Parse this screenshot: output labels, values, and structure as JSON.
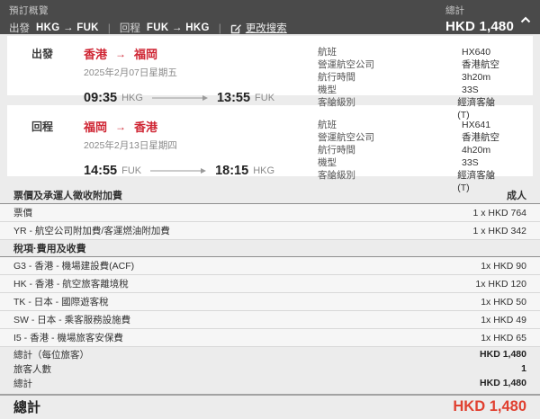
{
  "colors": {
    "header_bg": "#4a4a4a",
    "page_bg": "#ececec",
    "card_bg": "#ffffff",
    "brand_red": "#cf2634",
    "grand_total_red": "#e04030"
  },
  "icons": {
    "edit_icon": "edit-square-pencil",
    "chevron_up": "chevron-up",
    "route_arrow": "→"
  },
  "header": {
    "title": "預訂概覽",
    "depart_label": "出發",
    "depart_route": "HKG → FUK",
    "return_label": "回程",
    "return_route": "FUK → HKG",
    "change_search": "更改搜索",
    "total_label": "總計",
    "total_value": "HKD 1,480"
  },
  "flights": [
    {
      "direction_label": "出發",
      "from_city": "香港",
      "arrow": "→",
      "to_city": "福岡",
      "date": "2025年2月07日星期五",
      "dep_time": "09:35",
      "dep_code": "HKG",
      "arr_time": "13:55",
      "arr_code": "FUK",
      "details": [
        {
          "label": "航班",
          "value": "HX640"
        },
        {
          "label": "營運航空公司",
          "value": "香港航空"
        },
        {
          "label": "航行時間",
          "value": "3h20m"
        },
        {
          "label": "機型",
          "value": "33S"
        },
        {
          "label": "客艙級別",
          "value": "經濟客艙(T)"
        }
      ]
    },
    {
      "direction_label": "回程",
      "from_city": "福岡",
      "arrow": "→",
      "to_city": "香港",
      "date": "2025年2月13日星期四",
      "dep_time": "14:55",
      "dep_code": "FUK",
      "arr_time": "18:15",
      "arr_code": "HKG",
      "details": [
        {
          "label": "航班",
          "value": "HX641"
        },
        {
          "label": "營運航空公司",
          "value": "香港航空"
        },
        {
          "label": "航行時間",
          "value": "4h20m"
        },
        {
          "label": "機型",
          "value": "33S"
        },
        {
          "label": "客艙級別",
          "value": "經濟客艙(T)"
        }
      ]
    }
  ],
  "fare": {
    "section1_title": "票價及承運人徵收附加費",
    "pax_type": "成人",
    "section1_rows": [
      {
        "label": "票價",
        "value": "1 x HKD 764"
      },
      {
        "label": "YR - 航空公司附加費/客運燃油附加費",
        "value": "1 x HKD 342"
      }
    ],
    "section2_title": "稅項·費用及收費",
    "section2_rows": [
      {
        "label": "G3 - 香港 - 機場建設費(ACF)",
        "value": "1x HKD 90"
      },
      {
        "label": "HK - 香港 - 航空旅客離境稅",
        "value": "1x HKD 120"
      },
      {
        "label": "TK - 日本 - 國際遊客稅",
        "value": "1x HKD 50"
      },
      {
        "label": "SW - 日本 - 乘客服務設施費",
        "value": "1x HKD 49"
      },
      {
        "label": "I5 - 香港 - 機場旅客安保費",
        "value": "1x HKD 65"
      }
    ],
    "totals": [
      {
        "label": "總計（每位旅客）",
        "value": "HKD 1,480"
      },
      {
        "label": "旅客人數",
        "value": "1"
      },
      {
        "label": "總計",
        "value": "HKD 1,480"
      }
    ],
    "grand_total_label": "總計",
    "grand_total_value": "HKD 1,480"
  }
}
